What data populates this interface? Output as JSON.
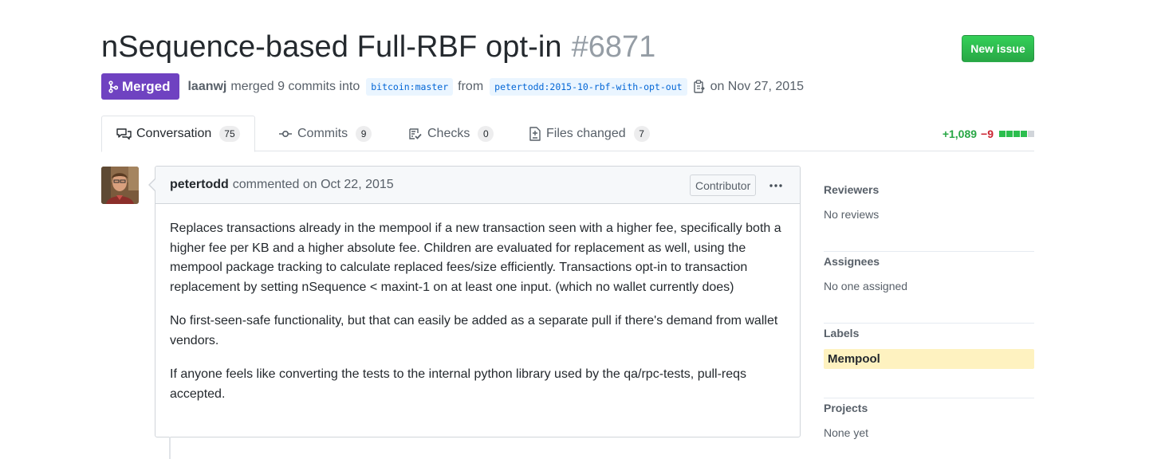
{
  "header": {
    "title": "nSequence-based Full-RBF opt-in",
    "number": "#6871",
    "new_issue_label": "New issue",
    "state": "Merged",
    "author": "laanwj",
    "action_text": "merged 9 commits into",
    "base_branch": "bitcoin:master",
    "from_text": "from",
    "head_branch": "petertodd:2015-10-rbf-with-opt-out",
    "date_text": "on Nov 27, 2015"
  },
  "tabs": [
    {
      "label": "Conversation",
      "count": "75",
      "icon": "comment-discussion-icon",
      "selected": true
    },
    {
      "label": "Commits",
      "count": "9",
      "icon": "git-commit-icon",
      "selected": false
    },
    {
      "label": "Checks",
      "count": "0",
      "icon": "checklist-icon",
      "selected": false
    },
    {
      "label": "Files changed",
      "count": "7",
      "icon": "file-diff-icon",
      "selected": false
    }
  ],
  "diffstat": {
    "additions": "+1,089",
    "deletions": "−9",
    "blocks": [
      "added",
      "added",
      "added",
      "added",
      "neutral"
    ]
  },
  "comment": {
    "author": "petertodd",
    "date_text": "commented on Oct 22, 2015",
    "role_badge": "Contributor",
    "paragraphs": [
      "Replaces transactions already in the mempool if a new transaction seen with a higher fee, specifically both a higher fee per KB and a higher absolute fee. Children are evaluated for replacement as well, using the mempool package tracking to calculate replaced fees/size efficiently. Transactions opt-in to transaction replacement by setting nSequence < maxint-1 on at least one input. (which no wallet currently does)",
      "No first-seen-safe functionality, but that can easily be added as a separate pull if there's demand from wallet vendors.",
      "If anyone feels like converting the tests to the internal python library used by the qa/rpc-tests, pull-reqs accepted."
    ]
  },
  "sidebar": {
    "reviewers": {
      "title": "Reviewers",
      "value": "No reviews"
    },
    "assignees": {
      "title": "Assignees",
      "value": "No one assigned"
    },
    "labels": {
      "title": "Labels",
      "items": [
        "Mempool"
      ]
    },
    "projects": {
      "title": "Projects",
      "value": "None yet"
    }
  },
  "colors": {
    "merged": "#6f42c1",
    "green": "#28a745",
    "red": "#cb2431",
    "label_mempool": "#fef2c0",
    "link": "#0366d6"
  }
}
